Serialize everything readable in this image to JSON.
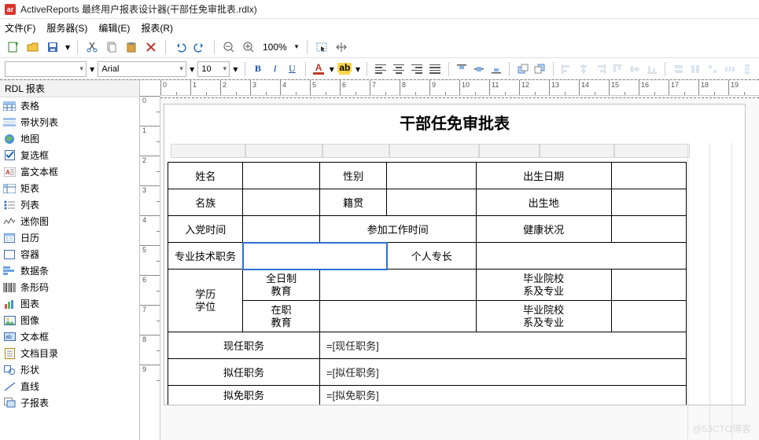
{
  "title": "ActiveReports 最终用户报表设计器(干部任免审批表.rdlx)",
  "menu": [
    "文件(F)",
    "服务器(S)",
    "编辑(E)",
    "报表(R)"
  ],
  "zoom": "100%",
  "font": {
    "family": "Arial",
    "size": "10",
    "bold": "B",
    "italic": "I",
    "underline": "U",
    "fgA": "A",
    "bgA": "A"
  },
  "sidebar": {
    "header": "RDL 报表",
    "items": [
      {
        "label": "表格",
        "icon": "table"
      },
      {
        "label": "带状列表",
        "icon": "banded"
      },
      {
        "label": "地图",
        "icon": "globe"
      },
      {
        "label": "复选框",
        "icon": "checkbox"
      },
      {
        "label": "富文本框",
        "icon": "richtext"
      },
      {
        "label": "矩表",
        "icon": "matrix"
      },
      {
        "label": "列表",
        "icon": "list"
      },
      {
        "label": "迷你图",
        "icon": "spark"
      },
      {
        "label": "日历",
        "icon": "calendar"
      },
      {
        "label": "容器",
        "icon": "container"
      },
      {
        "label": "数据条",
        "icon": "databar"
      },
      {
        "label": "条形码",
        "icon": "barcode"
      },
      {
        "label": "图表",
        "icon": "chart"
      },
      {
        "label": "图像",
        "icon": "image"
      },
      {
        "label": "文本框",
        "icon": "textbox"
      },
      {
        "label": "文档目录",
        "icon": "toc"
      },
      {
        "label": "形状",
        "icon": "shape"
      },
      {
        "label": "直线",
        "icon": "line"
      },
      {
        "label": "子报表",
        "icon": "subreport"
      }
    ]
  },
  "report": {
    "title": "干部任免审批表",
    "r1": {
      "c1": "姓名",
      "c3": "性别",
      "c5": "出生日期"
    },
    "r2": {
      "c1": "名族",
      "c3": "籍贯",
      "c5": "出生地"
    },
    "r3": {
      "c1": "入党时间",
      "c3": "参加工作时间",
      "c5": "健康状况"
    },
    "r4": {
      "c1": "专业技术职务",
      "c4": "个人专长"
    },
    "r5": {
      "c1a": "学历",
      "c1b": "学位",
      "c2a": "全日制",
      "c2b": "教育",
      "c5a": "毕业院校",
      "c5b": "系及专业"
    },
    "r6": {
      "c2a": "在职",
      "c2b": "教育",
      "c5a": "毕业院校",
      "c5b": "系及专业"
    },
    "r7": {
      "c1": "现任职务",
      "c2": "=[现任职务]"
    },
    "r8": {
      "c1": "拟任职务",
      "c2": "=[拟任职务]"
    },
    "r9": {
      "c1": "拟免职务",
      "c2": "=[拟免职务]"
    }
  },
  "ruler": [
    "0",
    "1",
    "2",
    "3",
    "4",
    "5",
    "6",
    "7",
    "8",
    "9",
    "10",
    "11",
    "12",
    "13",
    "14",
    "15",
    "16",
    "17",
    "18",
    "19"
  ],
  "vruler": [
    "0",
    "1",
    "2",
    "3",
    "4",
    "5",
    "6",
    "7",
    "8",
    "9"
  ],
  "watermark": "@53CTO博客"
}
